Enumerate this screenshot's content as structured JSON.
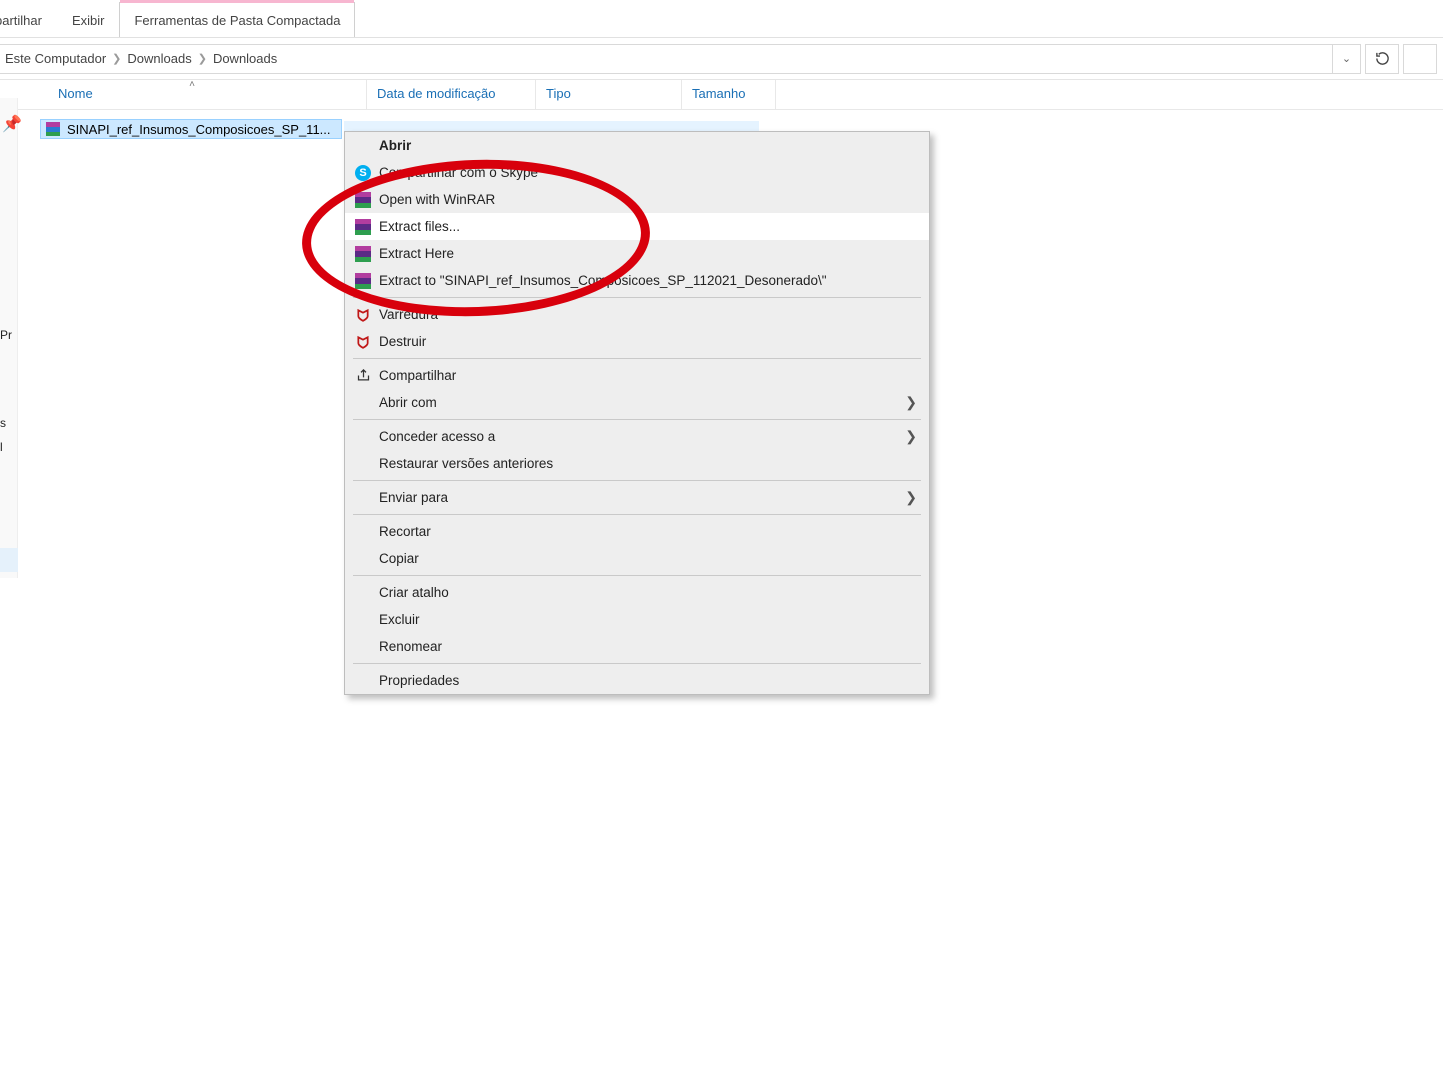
{
  "ribbon": {
    "tab_partilhar": "partilhar",
    "tab_exibir": "Exibir",
    "tab_compactada": "Ferramentas de Pasta Compactada"
  },
  "breadcrumb": {
    "root": "Este Computador",
    "downloads1": "Downloads",
    "downloads2": "Downloads"
  },
  "columns": {
    "nome": "Nome",
    "data": "Data de modificação",
    "tipo": "Tipo",
    "tamanho": "Tamanho"
  },
  "file": {
    "name": "SINAPI_ref_Insumos_Composicoes_SP_11..."
  },
  "nav": {
    "pr": "Pr",
    "s": "s",
    "l": "l"
  },
  "ctx": {
    "abrir": "Abrir",
    "skype": "Compartilhar com o Skype",
    "open_winrar": "Open with WinRAR",
    "extract_files": "Extract files...",
    "extract_here": "Extract Here",
    "extract_to": "Extract to \"SINAPI_ref_Insumos_Composicoes_SP_112021_Desonerado\\\"",
    "varredura": "Varredura",
    "destruir": "Destruir",
    "compartilhar": "Compartilhar",
    "abrir_com": "Abrir com",
    "conceder": "Conceder acesso a",
    "restaurar": "Restaurar versões anteriores",
    "enviar": "Enviar para",
    "recortar": "Recortar",
    "copiar": "Copiar",
    "atalho": "Criar atalho",
    "excluir": "Excluir",
    "renomear": "Renomear",
    "propriedades": "Propriedades"
  }
}
